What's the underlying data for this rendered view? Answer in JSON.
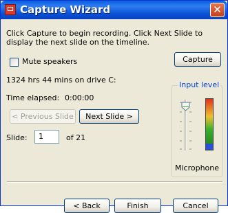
{
  "window": {
    "title": "Capture Wizard",
    "close_glyph": "✕"
  },
  "instructions": "Click Capture to begin recording. Click Next Slide to display the next slide on the timeline.",
  "capture_label": "Capture",
  "mute": {
    "label": "Mute speakers",
    "checked": false
  },
  "disk_space": "1324 hrs 44 mins on drive C:",
  "time_elapsed": {
    "label": "Time elapsed:",
    "value": "0:00:00"
  },
  "prev_slide_label": "< Previous Slide",
  "next_slide_label": "Next Slide >",
  "slide": {
    "label": "Slide:",
    "value": "1",
    "total": "of 21"
  },
  "input_level": {
    "title": "Input level",
    "source": "Microphone",
    "level_fraction": 0.12
  },
  "footer": {
    "back": "< Back",
    "finish": "Finish",
    "cancel": "Cancel"
  }
}
